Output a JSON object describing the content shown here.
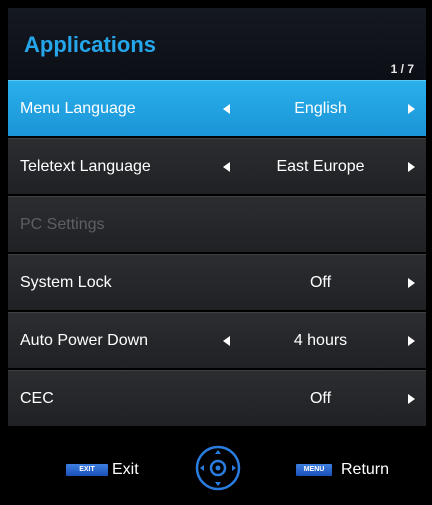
{
  "header": {
    "title": "Applications",
    "page_indicator": "1 / 7"
  },
  "menu": {
    "items": [
      {
        "label": "Menu Language",
        "value": "English",
        "has_left_arrow": true,
        "has_right_arrow": true,
        "selected": true,
        "disabled": false
      },
      {
        "label": "Teletext Language",
        "value": "East Europe",
        "has_left_arrow": true,
        "has_right_arrow": true,
        "selected": false,
        "disabled": false
      },
      {
        "label": "PC Settings",
        "value": "",
        "has_left_arrow": false,
        "has_right_arrow": false,
        "selected": false,
        "disabled": true
      },
      {
        "label": "System Lock",
        "value": "Off",
        "has_left_arrow": false,
        "has_right_arrow": true,
        "selected": false,
        "disabled": false
      },
      {
        "label": "Auto Power Down",
        "value": "4 hours",
        "has_left_arrow": true,
        "has_right_arrow": true,
        "selected": false,
        "disabled": false
      },
      {
        "label": "CEC",
        "value": "Off",
        "has_left_arrow": false,
        "has_right_arrow": true,
        "selected": false,
        "disabled": false
      }
    ]
  },
  "footer": {
    "exit_key": "EXIT",
    "exit_label": "Exit",
    "menu_key": "MENU",
    "return_label": "Return",
    "nav_icon": "navigation-pad-icon"
  },
  "colors": {
    "accent": "#26a6ea",
    "selected_row": "#1a94d6",
    "row_background": "#26282b",
    "disabled_text": "#5d5f64",
    "key_blue": "#2a62cc"
  }
}
